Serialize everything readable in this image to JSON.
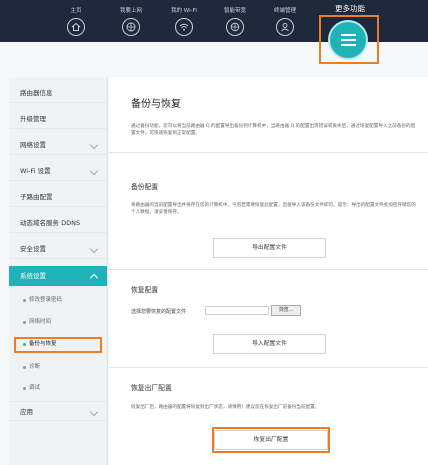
{
  "topnav": {
    "items": [
      {
        "label": "主页",
        "icon": "home-icon"
      },
      {
        "label": "我要上网",
        "icon": "globe-icon"
      },
      {
        "label": "我的 Wi-Fi",
        "icon": "wifi-icon"
      },
      {
        "label": "智能带宽",
        "icon": "bandwidth-icon"
      },
      {
        "label": "终端管理",
        "icon": "user-icon"
      }
    ],
    "more": {
      "label": "更多功能",
      "icon": "menu-icon"
    }
  },
  "sidebar": {
    "items": [
      {
        "label": "路由器信息"
      },
      {
        "label": "升级管理"
      },
      {
        "label": "网络设置"
      },
      {
        "label": "Wi-Fi 设置"
      },
      {
        "label": "子路由配置"
      },
      {
        "label": "动态域名服务 DDNS"
      },
      {
        "label": "安全设置"
      },
      {
        "label": "系统设置"
      }
    ],
    "subitems": [
      {
        "label": "修改登录密码"
      },
      {
        "label": "网络时间"
      },
      {
        "label": "备份与恢复"
      },
      {
        "label": "诊断"
      },
      {
        "label": "调试"
      }
    ],
    "bottom_item": {
      "label": "应用"
    }
  },
  "content": {
    "title": "备份与恢复",
    "description": "通过备份功能，您可以将当前路由器 Q 的配置导出备份到计算机中，当路由器 Q 的配置出现错误或丢失后，通过恢复配置导入之前备份的配置文件，可快速恢复到正常配置。",
    "backup": {
      "title": "备份配置",
      "text": "将路由器的当前配置导出并保存在您的计算机中，今后若需要恢复此配置，直接导入该备份文件即可。提示：导出的配置文件会加密存储您的个人数据，请妥善保存。",
      "button": "导出配置文件"
    },
    "restore": {
      "title": "恢复配置",
      "file_label": "选择您要恢复的配置文件",
      "browse": "浏览...",
      "button": "导入配置文件"
    },
    "factory": {
      "title": "恢复出厂配置",
      "text": "恢复出厂后，路由器的配置将恢复到出厂状态，请慎用！建议您在恢复出厂前备份当前配置。",
      "button": "恢复出厂配置"
    }
  },
  "colors": {
    "accent": "#1fb3b8",
    "highlight": "#f07c22",
    "topbar": "#1e2a3c"
  }
}
